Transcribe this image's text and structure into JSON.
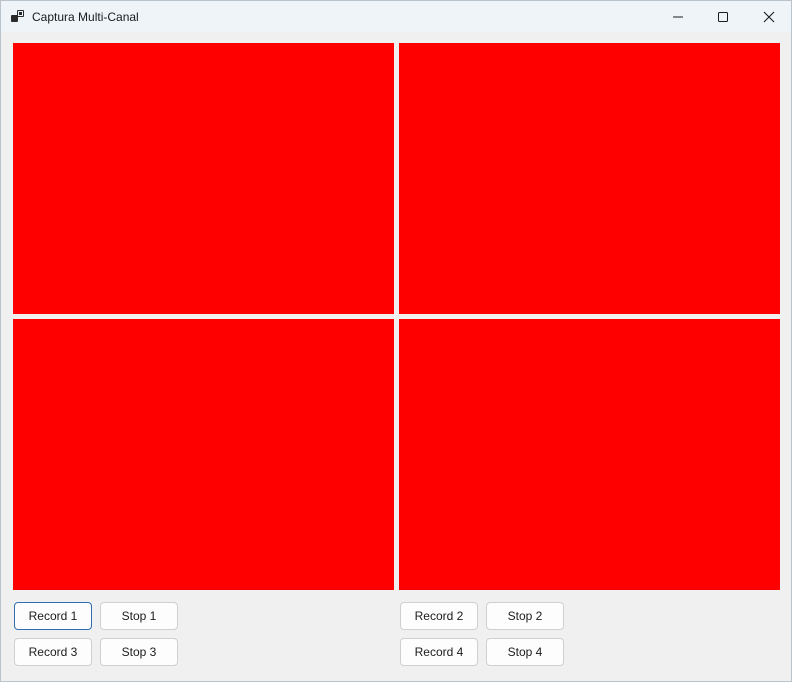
{
  "window": {
    "title": "Captura Multi-Canal",
    "app_icon": "app-window-icon",
    "caption_buttons": {
      "minimize_icon": "minimize-icon",
      "maximize_icon": "maximize-icon",
      "close_icon": "close-icon"
    }
  },
  "colors": {
    "panel": "#ff0000",
    "window_background": "#f0f0f0",
    "titlebar": "#eef4f8",
    "focus_border": "#2f6fb0"
  },
  "channels": [
    {
      "record_label": "Record 1",
      "stop_label": "Stop 1"
    },
    {
      "record_label": "Record 2",
      "stop_label": "Stop 2"
    },
    {
      "record_label": "Record 3",
      "stop_label": "Stop 3"
    },
    {
      "record_label": "Record 4",
      "stop_label": "Stop 4"
    }
  ]
}
